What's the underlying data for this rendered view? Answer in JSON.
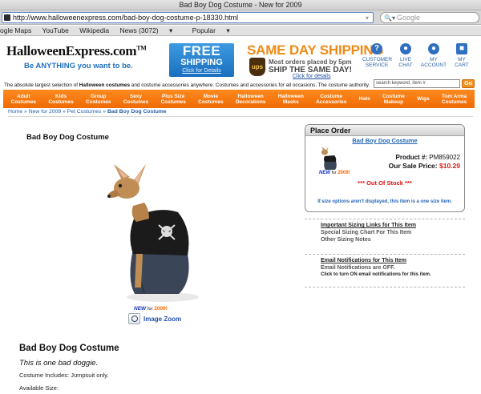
{
  "browser": {
    "window_title": "Bad Boy Dog Costume - New for 2009",
    "url": "http://www.halloweenexpress.com/bad-boy-dog-costume-p-18330.html",
    "search_placeholder": "Google",
    "bookmarks": [
      "ogle Maps",
      "YouTube",
      "Wikipedia",
      "News (3072)",
      "Popular"
    ]
  },
  "header": {
    "logo_text": "HalloweenExpress.com",
    "logo_tm": "TM",
    "logo_slogan": "Be ANYTHING you want to be.",
    "free_shipping": {
      "line1": "FREE",
      "line2": "SHIPPING",
      "link": "Click for Details"
    },
    "same_day": {
      "title": "SAME DAY SHIPPING",
      "ups": "ups",
      "line1": "Most orders placed by 5pm",
      "line2": "SHIP THE SAME DAY!",
      "link": "Click for details"
    },
    "icons": [
      {
        "label1": "CUSTOMER",
        "label2": "SERVICE",
        "glyph": "?"
      },
      {
        "label1": "LIVE",
        "label2": "CHAT",
        "glyph": "●"
      },
      {
        "label1": "MY",
        "label2": "ACCOUNT",
        "glyph": "●"
      },
      {
        "label1": "MY",
        "label2": "CART",
        "glyph": "■"
      }
    ],
    "tagline_pre": "The absolute largest selection of ",
    "tagline_bold": "Halloween costumes",
    "tagline_post": " and costume accessories anywhere. Costumes and accessories for all occasions. The costume authority.",
    "search_placeholder": "search keyword, item #",
    "search_go": "Go"
  },
  "nav": [
    [
      "Adult",
      "Costumes"
    ],
    [
      "Kids",
      "Costumes"
    ],
    [
      "Group",
      "Costumes"
    ],
    [
      "Sexy",
      "Costumes"
    ],
    [
      "Plus Size",
      "Costumes"
    ],
    [
      "Movie",
      "Costumes"
    ],
    [
      "Halloween",
      "Decorations"
    ],
    [
      "Halloween",
      "Masks"
    ],
    [
      "Costume",
      "Accessories"
    ],
    [
      "Hats",
      ""
    ],
    [
      "Costume",
      "Makeup"
    ],
    [
      "Wigs",
      ""
    ],
    [
      "Tom Arma",
      "Costumes"
    ]
  ],
  "breadcrumb": {
    "items": [
      "Home",
      "New for 2009",
      "Pet Costumes"
    ],
    "current": "Bad Boy Dog Costume",
    "sep": " » "
  },
  "product": {
    "title": "Bad Boy Dog Costume",
    "new_label": "NEW",
    "for_label": "for",
    "year_label": "2009!",
    "zoom_label": "Image Zoom",
    "big_title": "Bad Boy Dog Costume",
    "tagline": "This is one bad doggie.",
    "includes": "Costume Includes: Jumpsuit only.",
    "available_size": "Available Size:"
  },
  "order": {
    "header": "Place Order",
    "product_link": "Bad Boy Dog Costume",
    "product_no_label": "Product #:",
    "product_no": "PM859022",
    "price_label": "Our Sale Price:",
    "price": "$10.29",
    "stock": "*** Out Of Stock ***",
    "note": "If size options aren't displayed, this item is a one size item."
  },
  "sizing": {
    "title": "Important Sizing Links for This Item",
    "line1": "Special Sizing Chart For This Item",
    "line2": "Other Sizing Notes"
  },
  "notify": {
    "title": "Email Notifications for This Item",
    "line1": "Email Notifications are OFF.",
    "line2": "Click to turn ON email notifications for this item."
  },
  "colors": {
    "accent_orange": "#ee6a05",
    "link_blue": "#2466b7",
    "price_red": "#d81a1a"
  }
}
